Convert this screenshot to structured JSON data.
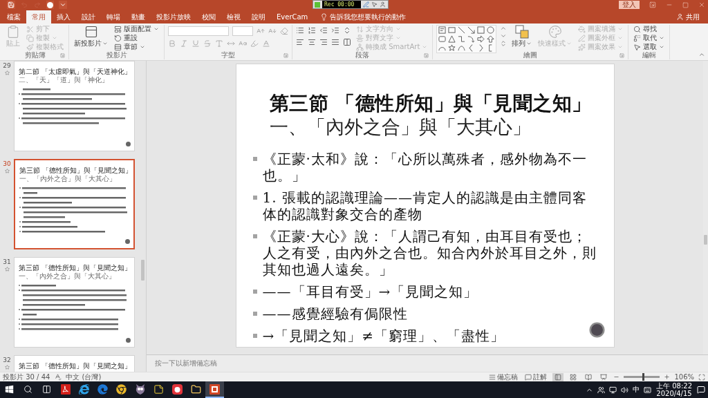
{
  "title_bar": {
    "quick_access": [
      {
        "disabled": false
      },
      {
        "disabled": true
      },
      {
        "disabled": true
      },
      {
        "disabled": false
      },
      {
        "disabled": false
      }
    ],
    "recorder": {
      "timer": "Rec 00:00"
    },
    "sign_in": "登入"
  },
  "tabs": [
    {
      "label": "檔案",
      "selected": false
    },
    {
      "label": "常用",
      "selected": true
    },
    {
      "label": "插入",
      "selected": false
    },
    {
      "label": "設計",
      "selected": false
    },
    {
      "label": "轉場",
      "selected": false
    },
    {
      "label": "動畫",
      "selected": false
    },
    {
      "label": "投影片放映",
      "selected": false
    },
    {
      "label": "校閱",
      "selected": false
    },
    {
      "label": "檢視",
      "selected": false
    },
    {
      "label": "說明",
      "selected": false
    },
    {
      "label": "EverCam",
      "selected": false
    }
  ],
  "tell_me": "告訴我您想要執行的動作",
  "share": "共用",
  "ribbon": [
    {
      "kind": "clipboard",
      "label": "剪貼簿",
      "items": [
        {
          "kind": "large",
          "label": "貼上",
          "disabled": true,
          "dropdown": false
        },
        {
          "kind": "small",
          "label": "剪下",
          "disabled": true,
          "dropdown": false
        },
        {
          "kind": "small",
          "label": "複製",
          "disabled": true,
          "dropdown": true
        },
        {
          "kind": "small",
          "label": "複製格式",
          "disabled": true,
          "dropdown": false
        }
      ]
    },
    {
      "kind": "slides",
      "label": "投影片",
      "items": [
        {
          "kind": "large",
          "label": "新投影片",
          "disabled": false,
          "dropdown": true
        },
        {
          "kind": "small",
          "label": "版面配置",
          "disabled": false,
          "dropdown": true
        },
        {
          "kind": "small",
          "label": "重設",
          "disabled": false,
          "dropdown": false
        },
        {
          "kind": "small",
          "label": "章節",
          "disabled": false,
          "dropdown": true
        }
      ]
    },
    {
      "kind": "font",
      "label": "字型"
    },
    {
      "kind": "paragraph",
      "label": "段落",
      "items": [
        {
          "kind": "small",
          "label": "文字方向",
          "disabled": true,
          "dropdown": true
        },
        {
          "kind": "small",
          "label": "對齊文字",
          "disabled": true,
          "dropdown": true
        },
        {
          "kind": "small",
          "label": "轉換成 SmartArt",
          "disabled": true,
          "dropdown": true
        }
      ]
    },
    {
      "kind": "drawing",
      "label": "繪圖",
      "items": [
        {
          "kind": "large",
          "label": "排列",
          "disabled": false,
          "dropdown": true
        },
        {
          "kind": "large",
          "label": "快速樣式",
          "disabled": true,
          "dropdown": true
        },
        {
          "kind": "small",
          "label": "圖案填滿",
          "disabled": true,
          "dropdown": true
        },
        {
          "kind": "small",
          "label": "圖案外框",
          "disabled": true,
          "dropdown": true
        },
        {
          "kind": "small",
          "label": "圖案效果",
          "disabled": true,
          "dropdown": true
        }
      ]
    },
    {
      "kind": "editing",
      "label": "編輯",
      "items": [
        {
          "kind": "small",
          "label": "尋找",
          "disabled": false,
          "dropdown": false
        },
        {
          "kind": "small",
          "label": "取代",
          "disabled": false,
          "dropdown": true
        },
        {
          "kind": "small",
          "label": "選取",
          "disabled": false,
          "dropdown": true
        }
      ]
    }
  ],
  "slides_pane": {
    "thumbnails": [
      {
        "number": "29",
        "title": "第二節 「太虛即氣」與「天道神化」",
        "subtitle": "二、「天」「道」與「神化」",
        "selected": false
      },
      {
        "number": "30",
        "title": "第三節 「德性所知」與「見聞之知」",
        "subtitle": "一、「內外之合」與「大其心」",
        "selected": true
      },
      {
        "number": "31",
        "title": "第三節 「德性所知」與「見聞之知」",
        "subtitle": "一、「內外之合」與「大其心」",
        "selected": false
      },
      {
        "number": "32",
        "title": "第三節 「德性所知」與「見聞之知」",
        "selected": false
      }
    ]
  },
  "slide": {
    "title": "第三節 「德性所知」與「見聞之知」",
    "subtitle": "一、「內外之合」與「大其心」",
    "bullets": [
      "《正蒙·太和》說：「心所以萬殊者，感外物為不一也。」",
      "1. 張載的認識理論——肯定人的認識是由主體同客体的認識對象交合的產物",
      "《正蒙·大心》說：「人謂己有知，由耳目有受也；人之有受，由內外之合也。知合內外於耳目之外，則其知也過人遠矣。」",
      "——「耳目有受」→「見聞之知」",
      "——感覺經驗有侷限性",
      "→「見聞之知」≠「窮理」、「盡性」"
    ]
  },
  "notes": {
    "placeholder": "按一下以新增備忘稿"
  },
  "status_bar": {
    "slide_count": "投影片 30 / 44",
    "language": "中文 (台灣)",
    "notes": "備忘稿",
    "comments": "註解",
    "views": [
      {
        "selected": true
      },
      {
        "selected": false
      },
      {
        "selected": false
      },
      {
        "selected": false
      }
    ],
    "zoom": {
      "level": 0.53,
      "reading": "106%"
    }
  },
  "taskbar": {
    "apps": [
      {
        "kind": "start",
        "active": false
      },
      {
        "kind": "search",
        "active": false
      },
      {
        "kind": "taskview",
        "active": false
      },
      {
        "kind": "pdf",
        "active": false
      },
      {
        "kind": "ie",
        "active": false
      },
      {
        "kind": "edge",
        "active": false
      },
      {
        "kind": "chrome",
        "active": false
      },
      {
        "kind": "owl",
        "active": false
      },
      {
        "kind": "sticky",
        "active": false
      },
      {
        "kind": "redapp",
        "active": false
      },
      {
        "kind": "folder",
        "active": false
      },
      {
        "kind": "slides",
        "active": true
      }
    ],
    "ime": "中",
    "time": "上午 08:22",
    "date": "2020/4/15"
  }
}
